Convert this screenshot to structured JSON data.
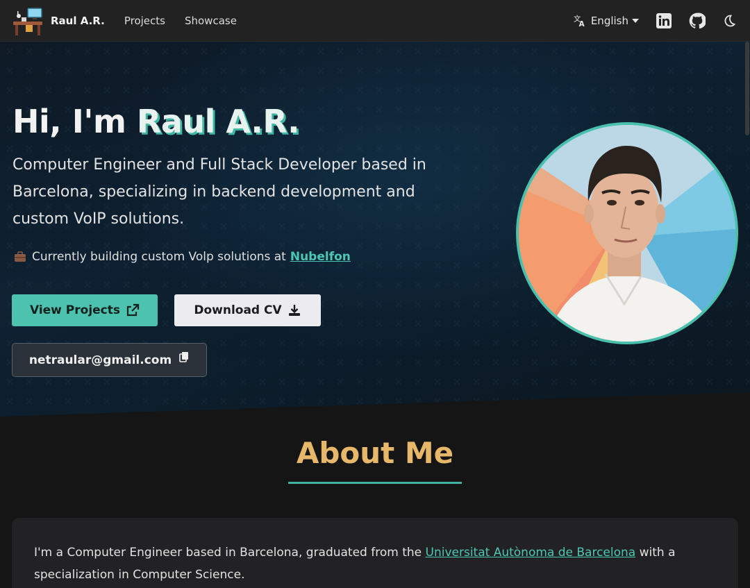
{
  "nav": {
    "brand": "Raul A.R.",
    "links": [
      "Projects",
      "Showcase"
    ],
    "language": "English",
    "icons": [
      "translate-icon",
      "linkedin-icon",
      "github-icon",
      "moon-icon"
    ]
  },
  "hero": {
    "greeting": "Hi, I'm ",
    "name": "Raul A.R.",
    "description": "Computer Engineer and Full Stack Developer based in Barcelona, specializing in backend development and custom VoIP solutions.",
    "current_prefix": "Currently building custom Volp solutions at",
    "current_company": "Nubelfon",
    "btn_projects": "View Projects",
    "btn_cv": "Download CV",
    "email": "netraular@gmail.com"
  },
  "about": {
    "title": "About Me",
    "text_before": "I'm a Computer Engineer based in Barcelona, graduated from the ",
    "university": "Universitat Autònoma de Barcelona",
    "text_after": " with a specialization in Computer Science."
  },
  "colors": {
    "accent": "#4dc2ae",
    "about_title": "#e8b86a",
    "navbar": "#222222",
    "page_bg": "#151515"
  }
}
